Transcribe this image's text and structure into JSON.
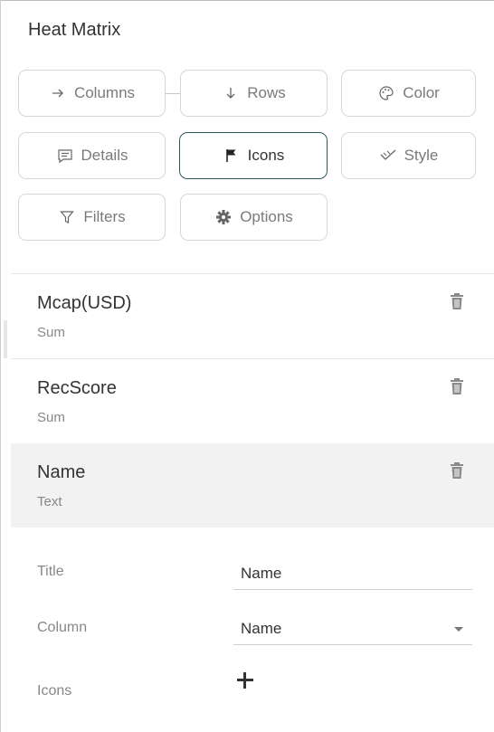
{
  "panel": {
    "title": "Heat Matrix"
  },
  "toolbar": {
    "columns_label": "Columns",
    "rows_label": "Rows",
    "color_label": "Color",
    "details_label": "Details",
    "icons_label": "Icons",
    "style_label": "Style",
    "filters_label": "Filters",
    "options_label": "Options",
    "active_tab": "Icons"
  },
  "items": [
    {
      "name": "Mcap(USD)",
      "aggregation": "Sum"
    },
    {
      "name": "RecScore",
      "aggregation": "Sum"
    },
    {
      "name": "Name",
      "aggregation": "Text",
      "selected": true
    }
  ],
  "form": {
    "title_label": "Title",
    "title_value": "Name",
    "column_label": "Column",
    "column_value": "Name",
    "icons_label": "Icons"
  },
  "colors": {
    "active_border": "#2e5d66",
    "selected_bg": "#f2f2f2"
  }
}
